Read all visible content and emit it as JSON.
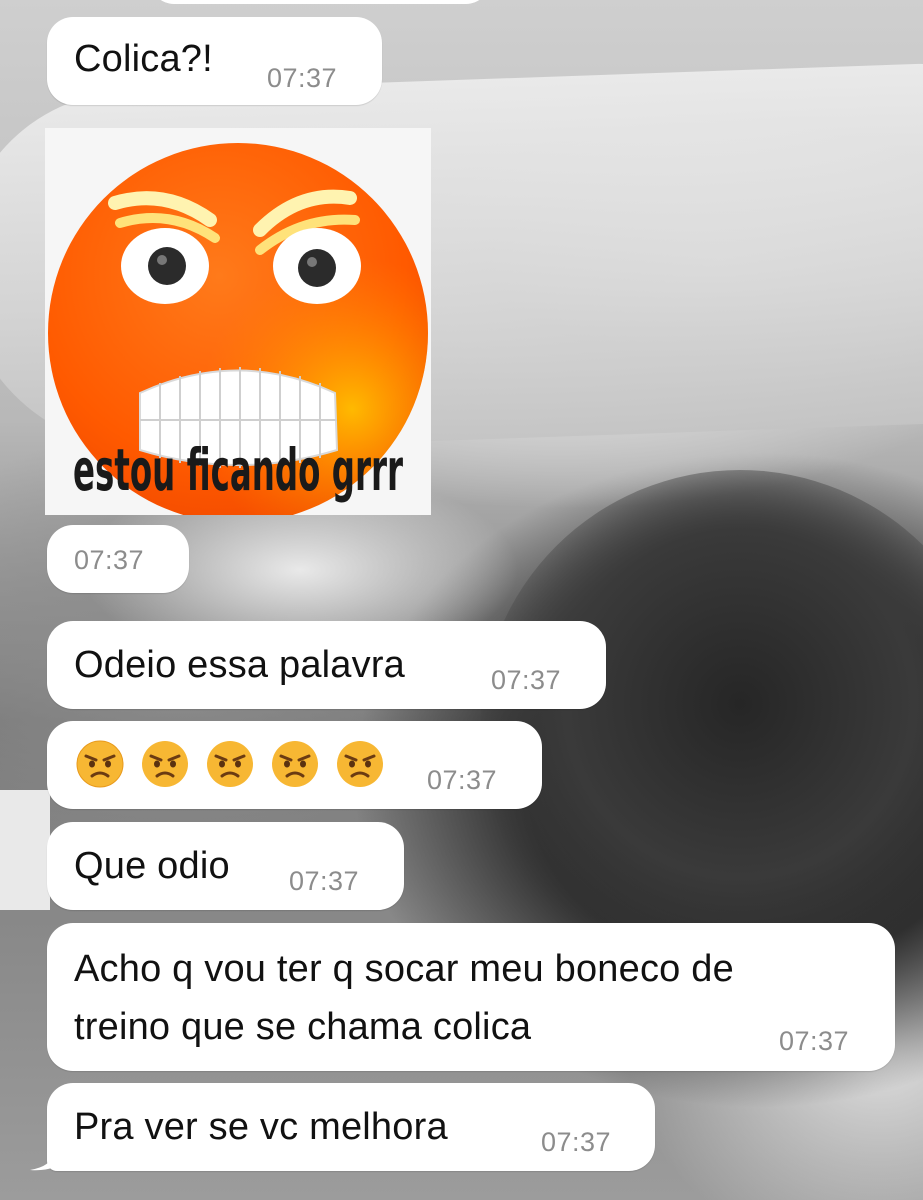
{
  "messages": [
    {
      "id": "m1",
      "text": "Colica?!",
      "time": "07:37"
    },
    {
      "id": "m2",
      "type": "sticker",
      "sticker_text": "estou ficando grrr",
      "time": "07:37"
    },
    {
      "id": "m3",
      "text": "Odeio essa palavra",
      "time": "07:37"
    },
    {
      "id": "m4",
      "type": "emoji",
      "emoji": [
        "angry-face",
        "angry-face",
        "angry-face",
        "angry-face",
        "angry-face"
      ],
      "time": "07:37"
    },
    {
      "id": "m5",
      "text": "Que odio",
      "time": "07:37"
    },
    {
      "id": "m6",
      "text_lines": [
        "Acho q vou ter q socar meu boneco de",
        "treino que se chama colica"
      ],
      "time": "07:37"
    },
    {
      "id": "m7",
      "text": "Pra ver se vc melhora",
      "time": "07:37"
    }
  ],
  "colors": {
    "bubble": "#ffffff",
    "text": "#111111",
    "time": "#8c8c8c",
    "sticker_face": "#ff5a00"
  }
}
